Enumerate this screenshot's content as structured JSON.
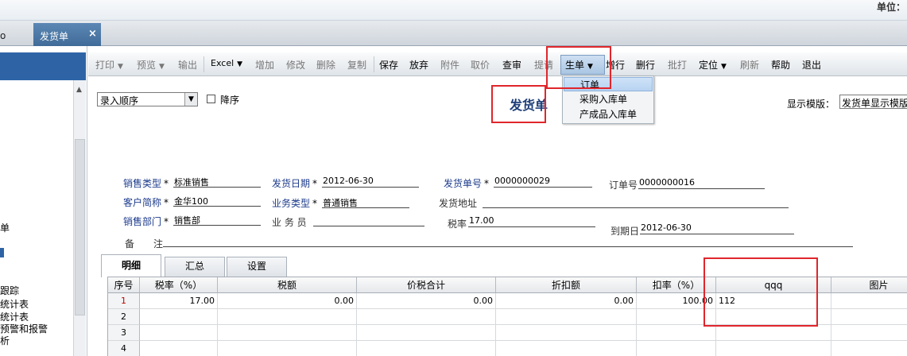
{
  "window": {
    "unit_label": "单位："
  },
  "tabs": {
    "left_fragment": "o",
    "active_tab": {
      "label": "发货单",
      "close": "×"
    }
  },
  "sidebar": {
    "items": [
      "单",
      "",
      "",
      "跟踪",
      "统计表",
      "统计表",
      "预警和报警",
      "析"
    ]
  },
  "toolbar": {
    "buttons": [
      {
        "label": "打印",
        "drop": "▼",
        "enabled": false
      },
      {
        "label": "预览",
        "drop": "▼",
        "enabled": false
      },
      {
        "label": "输出",
        "enabled": false
      },
      {
        "label": "Excel",
        "drop": "▼",
        "enabled": true
      },
      {
        "label": "增加",
        "enabled": false
      },
      {
        "label": "修改",
        "enabled": false
      },
      {
        "label": "删除",
        "enabled": false
      },
      {
        "label": "复制",
        "enabled": false
      },
      {
        "label": "保存",
        "enabled": true
      },
      {
        "label": "放弃",
        "enabled": true
      },
      {
        "label": "附件",
        "enabled": false
      },
      {
        "label": "取价",
        "enabled": false
      },
      {
        "label": "查审",
        "enabled": true
      },
      {
        "label": "提请",
        "enabled": false
      },
      {
        "label": "生单",
        "drop": "▼",
        "enabled": true
      },
      {
        "label": "增行",
        "enabled": true
      },
      {
        "label": "删行",
        "enabled": true
      },
      {
        "label": "批打",
        "enabled": false
      },
      {
        "label": "定位",
        "drop": "▼",
        "enabled": true
      },
      {
        "label": "刷新",
        "enabled": false
      },
      {
        "label": "帮助",
        "enabled": true
      },
      {
        "label": "退出",
        "enabled": true
      }
    ]
  },
  "generate_menu": {
    "items": [
      "订单",
      "采购入库单",
      "产成品入库单"
    ]
  },
  "header": {
    "order_select": "录入顺序",
    "select_arrow": "▼",
    "descending_label": "降序",
    "title": "发货单",
    "template_label": "显示模版：",
    "template_value": "发货单显示模版"
  },
  "fields": {
    "sales_type": {
      "label": "销售类型",
      "value": "标准销售"
    },
    "ship_date": {
      "label": "发货日期",
      "value": "2012-06-30"
    },
    "ship_no": {
      "label": "发货单号",
      "value": "0000000029"
    },
    "order_no": {
      "label": "订单号",
      "value": "0000000016"
    },
    "customer": {
      "label": "客户简称",
      "value": "金华100"
    },
    "biz_type": {
      "label": "业务类型",
      "value": "普通销售"
    },
    "ship_addr": {
      "label": "发货地址",
      "value": ""
    },
    "sales_dept": {
      "label": "销售部门",
      "value": "销售部"
    },
    "salesman": {
      "label": "业 务 员",
      "value": ""
    },
    "tax_rate": {
      "label": "税率",
      "value": "17.00"
    },
    "due_date": {
      "label": "到期日",
      "value": "2012-06-30"
    },
    "remark": {
      "label": "备　　注",
      "value": ""
    },
    "required_mark": "*"
  },
  "detail_tabs": [
    "明细",
    "汇总",
    "设置"
  ],
  "grid": {
    "columns": [
      "序号",
      "税率（%）",
      "税额",
      "价税合计",
      "折扣额",
      "扣率（%）",
      "qqq",
      "图片"
    ],
    "rows": [
      [
        "1",
        "17.00",
        "0.00",
        "0.00",
        "0.00",
        "100.00",
        "112",
        ""
      ],
      [
        "2",
        "",
        "",
        "",
        "",
        "",
        "",
        ""
      ],
      [
        "3",
        "",
        "",
        "",
        "",
        "",
        "",
        ""
      ],
      [
        "4",
        "",
        "",
        "",
        "",
        "",
        "",
        ""
      ]
    ]
  }
}
